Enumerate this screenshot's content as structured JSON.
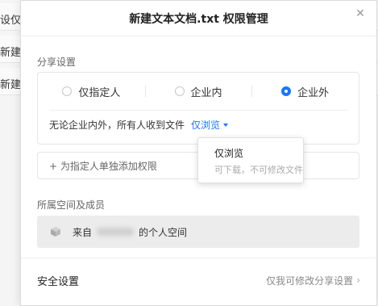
{
  "background": {
    "rows": [
      {
        "left_text": "设仅.t",
        "right_text": "b"
      },
      {
        "left_text": "新建文",
        "right_text": "d"
      },
      {
        "left_text": "新建文",
        "right_text": "d"
      }
    ]
  },
  "modal": {
    "title": "新建文本文档.txt 权限管理",
    "close_icon": "close-icon"
  },
  "share": {
    "section_label": "分享设置",
    "options": [
      {
        "label": "仅指定人",
        "checked": false
      },
      {
        "label": "企业内",
        "checked": false
      },
      {
        "label": "企业外",
        "checked": true
      }
    ],
    "description": "无论企业内外，所有人收到文件",
    "permission_value": "仅浏览"
  },
  "add_permission": {
    "label": "+ 为指定人单独添加权限"
  },
  "space": {
    "section_label": "所属空间及成员",
    "prefix": "来自",
    "suffix": "的个人空间",
    "icon": "cube-icon"
  },
  "security": {
    "title": "安全设置",
    "right_text": "仅我可修改分享设置",
    "chevron": "›"
  },
  "dropdown": {
    "option_title": "仅浏览",
    "option_desc": "可下载，不可修改文件"
  },
  "colors": {
    "accent": "#1677ff"
  }
}
